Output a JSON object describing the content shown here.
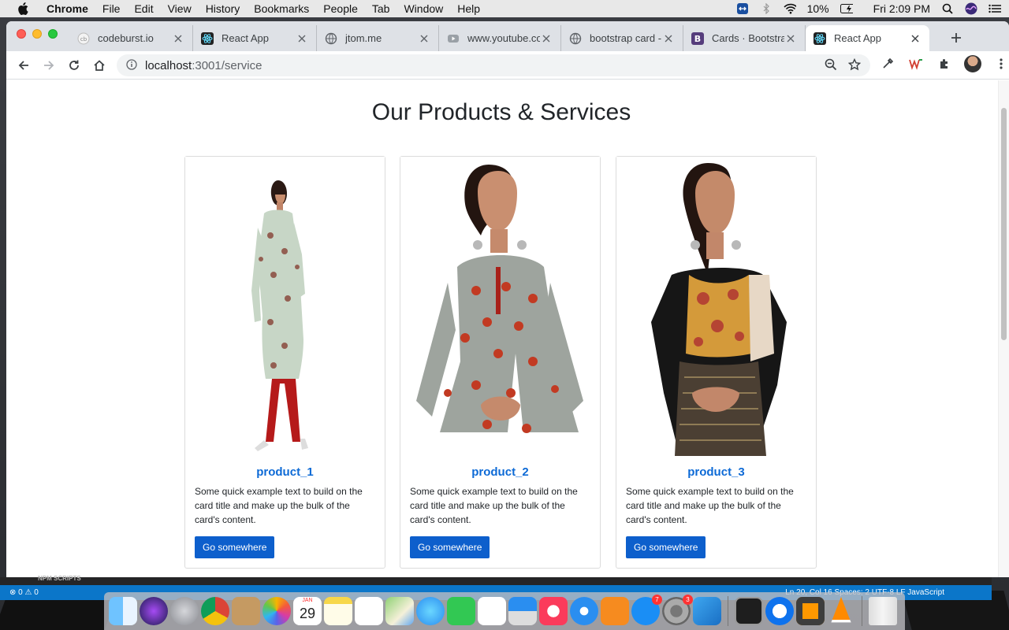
{
  "menubar": {
    "app_name": "Chrome",
    "items": [
      "File",
      "Edit",
      "View",
      "History",
      "Bookmarks",
      "People",
      "Tab",
      "Window",
      "Help"
    ],
    "battery": "10%",
    "clock": "Fri 2:09 PM"
  },
  "browser": {
    "tabs": [
      {
        "title": "codeburst.io",
        "icon": "codeburst-icon"
      },
      {
        "title": "React App",
        "icon": "react-icon"
      },
      {
        "title": "jtom.me",
        "icon": "globe-icon"
      },
      {
        "title": "www.youtube.co",
        "icon": "video-icon"
      },
      {
        "title": "bootstrap card -",
        "icon": "globe-icon"
      },
      {
        "title": "Cards · Bootstra",
        "icon": "bootstrap-icon"
      },
      {
        "title": "React App",
        "icon": "react-icon"
      }
    ],
    "url_host": "localhost",
    "url_path": ":3001/service"
  },
  "page": {
    "title": "Our Products & Services",
    "cards": [
      {
        "title": "product_1",
        "text": "Some quick example text to build on the card title and make up the bulk of the card's content.",
        "button": "Go somewhere"
      },
      {
        "title": "product_2",
        "text": "Some quick example text to build on the card title and make up the bulk of the card's content.",
        "button": "Go somewhere"
      },
      {
        "title": "product_3",
        "text": "Some quick example text to build on the card title and make up the bulk of the card's content.",
        "button": "Go somewhere"
      }
    ]
  },
  "vscode": {
    "panel_label": "NPM SCRIPTS",
    "status_left": "⊗ 0 ⚠ 0",
    "status_right": "Ln 20, Col 16   Spaces: 2   UTF-8   LF   JavaScript"
  },
  "dock": {
    "calendar_month": "JAN",
    "calendar_day": "29",
    "appstore_badge": "7",
    "prefs_badge": "3"
  },
  "colors": {
    "accent": "#0d6ad6",
    "button": "#0d5fcc",
    "tabstrip": "#dee1e6"
  }
}
